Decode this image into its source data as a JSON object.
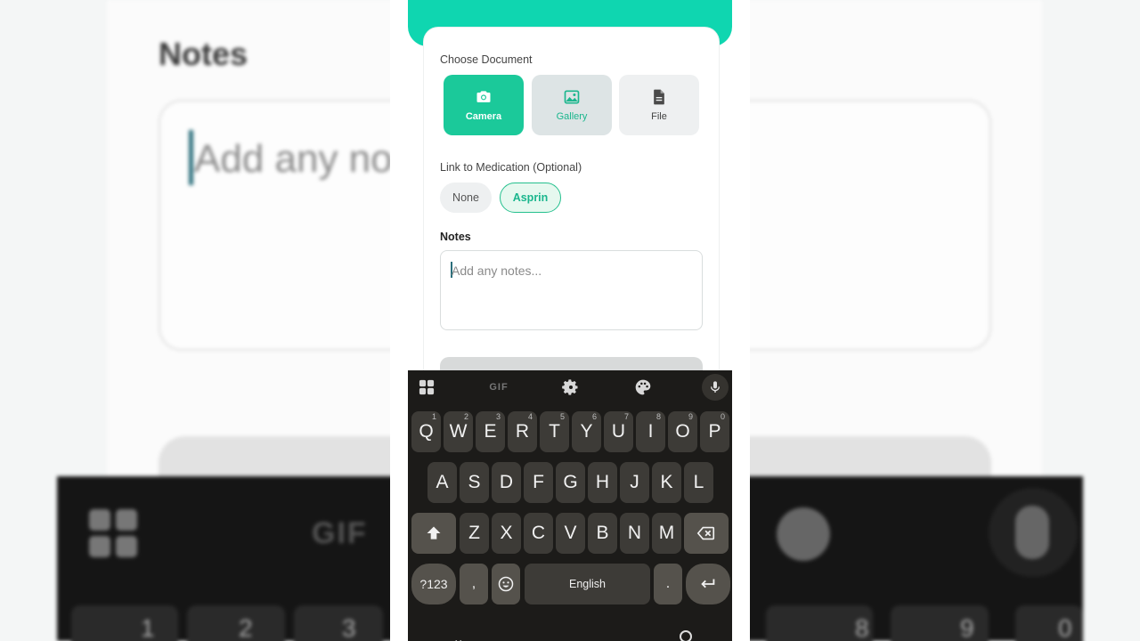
{
  "background": {
    "title": "Notes",
    "placeholder": "Add any no",
    "keyboard_gif": "GIF",
    "number_row": [
      "1",
      "2",
      "3",
      "8",
      "9",
      "0"
    ]
  },
  "form": {
    "choose_document_label": "Choose Document",
    "documents": [
      {
        "label": "Camera",
        "icon": "camera-icon"
      },
      {
        "label": "Gallery",
        "icon": "image-icon"
      },
      {
        "label": "File",
        "icon": "file-icon"
      }
    ],
    "medication_label": "Link to Medication (Optional)",
    "medication_options": [
      "None",
      "Asprin"
    ],
    "notes_label": "Notes",
    "notes_placeholder": "Add any notes..."
  },
  "keyboard": {
    "toolbar": {
      "gif": "GIF"
    },
    "row1": [
      {
        "k": "Q",
        "n": "1"
      },
      {
        "k": "W",
        "n": "2"
      },
      {
        "k": "E",
        "n": "3"
      },
      {
        "k": "R",
        "n": "4"
      },
      {
        "k": "T",
        "n": "5"
      },
      {
        "k": "Y",
        "n": "6"
      },
      {
        "k": "U",
        "n": "7"
      },
      {
        "k": "I",
        "n": "8"
      },
      {
        "k": "O",
        "n": "9"
      },
      {
        "k": "P",
        "n": "0"
      }
    ],
    "row2": [
      "A",
      "S",
      "D",
      "F",
      "G",
      "H",
      "J",
      "K",
      "L"
    ],
    "row3": [
      "Z",
      "X",
      "C",
      "V",
      "B",
      "N",
      "M"
    ],
    "symbols_key": "?123",
    "comma_key": ",",
    "space_key": "English",
    "period_key": "."
  },
  "colors": {
    "accent": "#1bc99a",
    "header": "#0fd6b0",
    "keyboard_bg": "#1c1b19",
    "key_bg": "#3d3b37"
  }
}
